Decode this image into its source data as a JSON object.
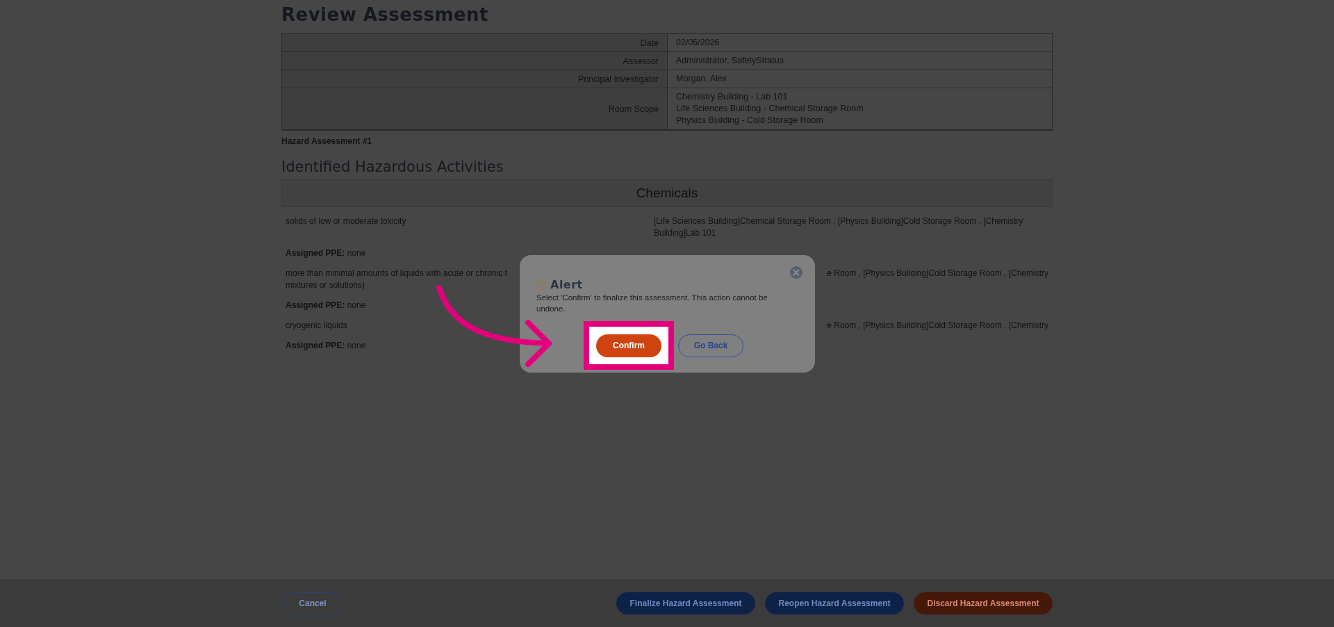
{
  "page": {
    "title": "Review Assessment"
  },
  "details": [
    {
      "label": "Date",
      "lines": [
        "02/05/2026"
      ]
    },
    {
      "label": "Assessor",
      "lines": [
        "Administrator, SafetyStratus"
      ]
    },
    {
      "label": "Principal Investigator",
      "lines": [
        "Morgan, Alex"
      ]
    },
    {
      "label": "Room Scope",
      "lines": [
        "Chemistry Building - Lab 101",
        "Life Sciences Building - Chemical Storage Room",
        "Physics Building - Cold Storage Room"
      ]
    }
  ],
  "assessment_label": "Hazard Assessment #1",
  "section_title": "Identified Hazardous Activities",
  "category": "Chemicals",
  "activities": [
    {
      "activity": [
        "solids of low or moderate toxicity"
      ],
      "locations": [
        "[Life Sciences Building]Chemical Storage Room , [Physics Building]Cold Storage Room , [Chemistry",
        "Building]Lab 101"
      ],
      "partly_covered": false,
      "ppe": "**Assigned PPE:** none"
    },
    {
      "activity": [
        "more than minimal amounts of liquids with acute or chronic t",
        "mixtures or solutions)"
      ],
      "locations": [
        "e Room , [Physics Building]Cold Storage Room , [Chemistry"
      ],
      "partly_covered": true,
      "ppe": "**Assigned PPE:** none"
    },
    {
      "activity": [
        "cryogenic liquids"
      ],
      "locations": [
        "e Room , [Physics Building]Cold Storage Room , [Chemistry"
      ],
      "partly_covered": true,
      "ppe": "**Assigned PPE:** none"
    }
  ],
  "footer": {
    "buttons": [
      {
        "label": "Cancel",
        "kind": "outline"
      },
      {
        "label": "Finalize Hazard Assessment",
        "kind": "primary"
      },
      {
        "label": "Reopen Hazard Assessment",
        "kind": "primary"
      },
      {
        "label": "Discard Hazard Assessment",
        "kind": "danger"
      }
    ]
  },
  "alert": {
    "title": "Alert",
    "message": "Select 'Confirm' to finalize this assessment. This action cannot be undone.",
    "buttons": [
      {
        "label": "Confirm",
        "kind": "solid",
        "highlighted": true
      },
      {
        "label": "Go Back",
        "kind": "outline",
        "highlighted": false
      }
    ]
  }
}
